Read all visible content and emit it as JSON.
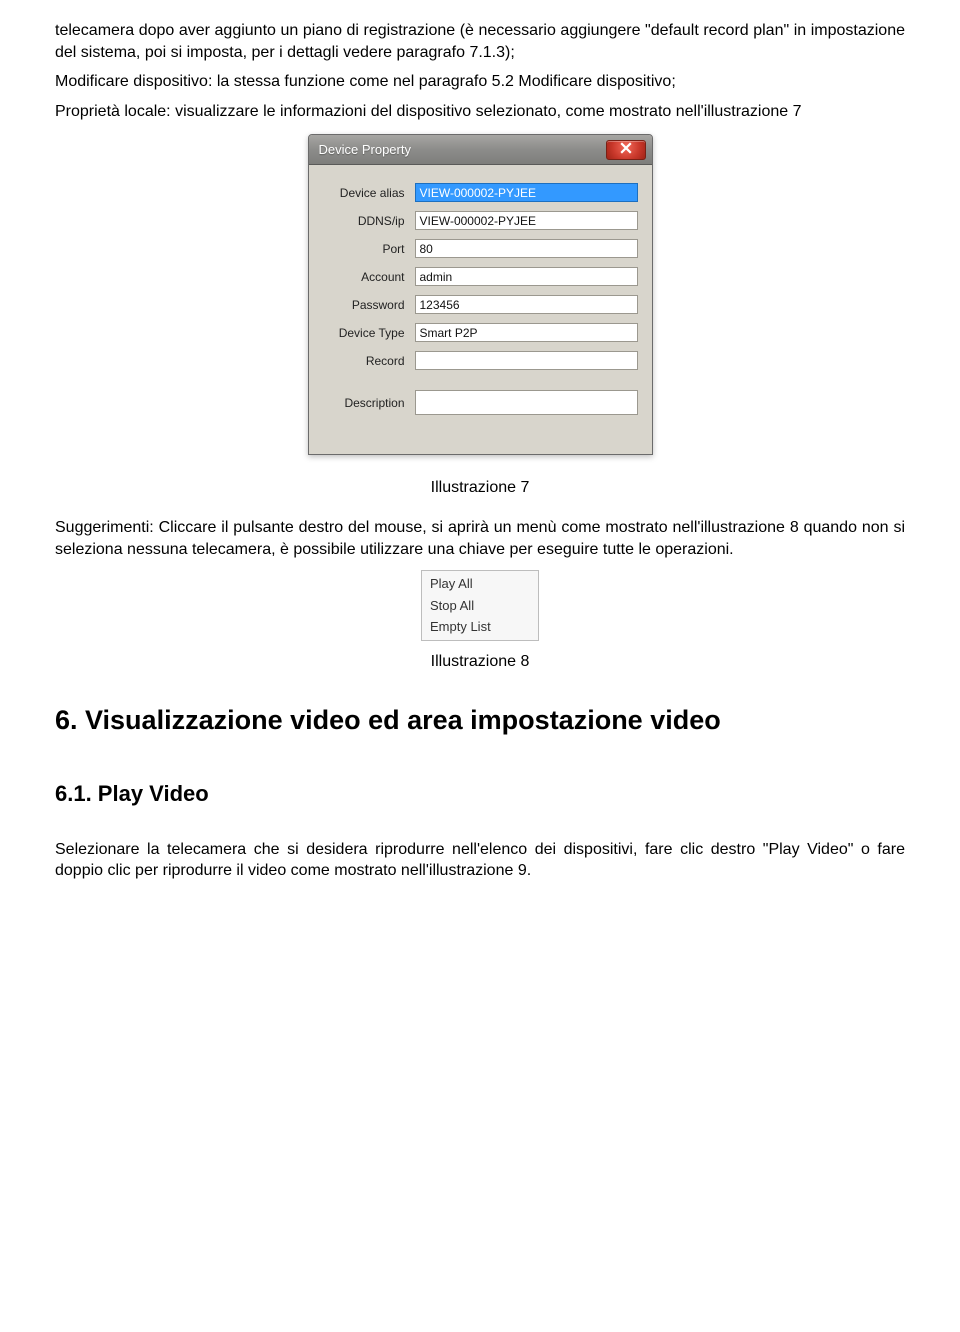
{
  "body": {
    "p1": "telecamera dopo aver aggiunto un piano di registrazione (è necessario aggiungere \"default record plan\" in impostazione del sistema, poi si imposta, per i dettagli vedere paragrafo 7.1.3);",
    "p2": "Modificare dispositivo: la stessa funzione come nel paragrafo 5.2 Modificare dispositivo;",
    "p3": "Proprietà locale: visualizzare le informazioni del dispositivo selezionato, come mostrato nell'illustrazione 7",
    "caption7": "Illustrazione 7",
    "hints": "Suggerimenti: Cliccare il pulsante destro del mouse, si aprirà un menù come mostrato nell'illustrazione 8 quando non si seleziona nessuna telecamera, è possibile utilizzare una chiave per eseguire tutte le operazioni.",
    "caption8": "Illustrazione 8",
    "h2": "6. Visualizzazione video ed area impostazione video",
    "h3": "6.1. Play Video",
    "p4": "Selezionare la telecamera che si desidera riprodurre nell'elenco dei dispositivi, fare clic destro \"Play Video\" o fare doppio clic per riprodurre il video come mostrato nell'illustrazione 9."
  },
  "dialog": {
    "title": "Device Property",
    "fields": {
      "alias_label": "Device alias",
      "alias_value": "VIEW-000002-PYJEE",
      "ddns_label": "DDNS/ip",
      "ddns_value": "VIEW-000002-PYJEE",
      "port_label": "Port",
      "port_value": "80",
      "account_label": "Account",
      "account_value": "admin",
      "password_label": "Password",
      "password_value": "123456",
      "type_label": "Device Type",
      "type_value": "Smart P2P",
      "record_label": "Record",
      "record_value": "",
      "desc_label": "Description",
      "desc_value": ""
    }
  },
  "menu": {
    "play_all": "Play All",
    "stop_all": "Stop All",
    "empty_list": "Empty List"
  }
}
